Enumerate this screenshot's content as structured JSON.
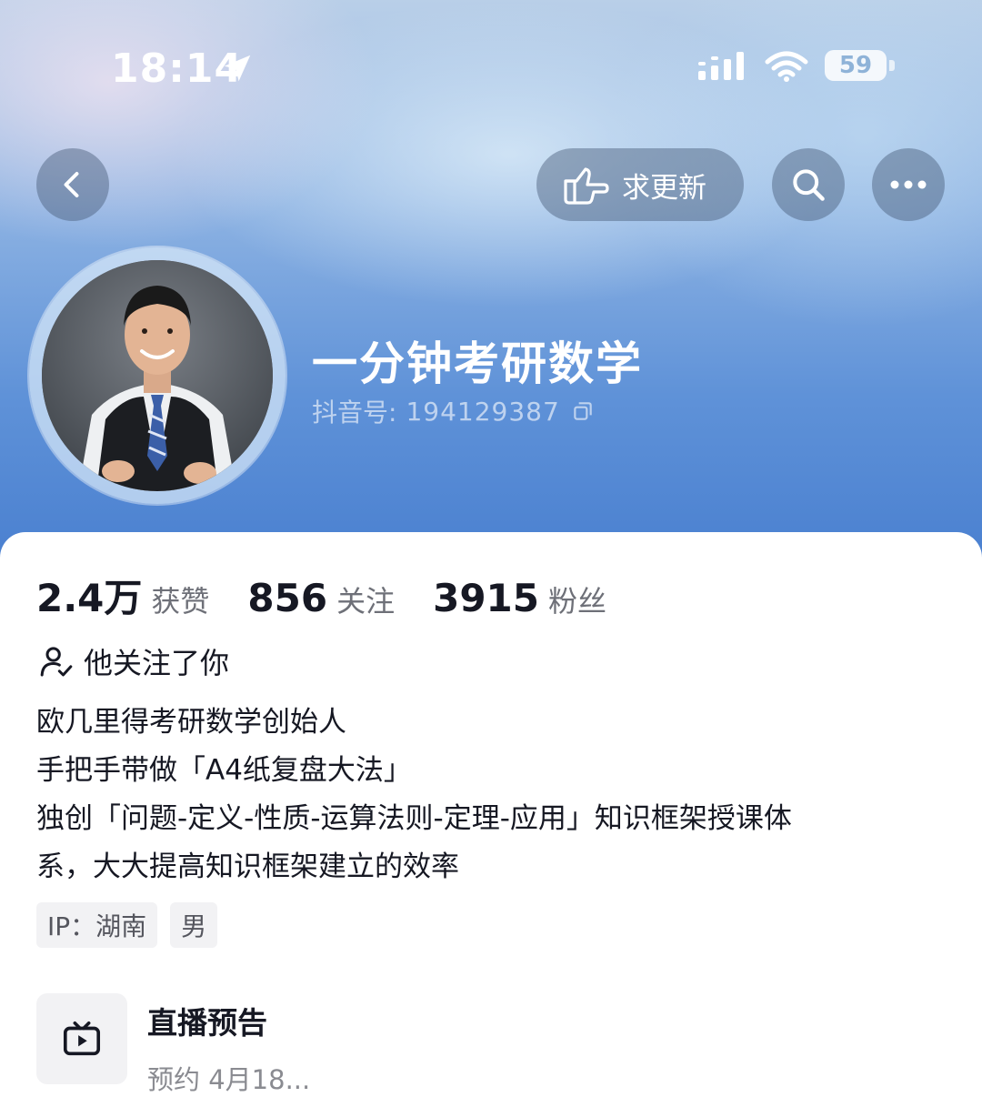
{
  "status_bar": {
    "time": "18:14",
    "battery": "59"
  },
  "header": {
    "request_update_label": "求更新"
  },
  "profile": {
    "name": "一分钟考研数学",
    "douyin_id_label": "抖音号:",
    "douyin_id": "194129387"
  },
  "stats": [
    {
      "value": "2.4万",
      "label": "获赞"
    },
    {
      "value": "856",
      "label": "关注"
    },
    {
      "value": "3915",
      "label": "粉丝"
    }
  ],
  "follows_you": "他关注了你",
  "bio": [
    "欧几里得考研数学创始人",
    "手把手带做「A4纸复盘大法」",
    "独创「问题-定义-性质-运算法则-定理-应用」知识框架授课体",
    "系，大大提高知识框架建立的效率"
  ],
  "tags": [
    "IP：湖南",
    "男"
  ],
  "live_preview": {
    "title": "直播预告",
    "subtitle": "预约 4月18..."
  },
  "colors": {
    "hero_blue": "#5f92d8",
    "text_primary": "#161823",
    "text_secondary": "#6e7078"
  }
}
